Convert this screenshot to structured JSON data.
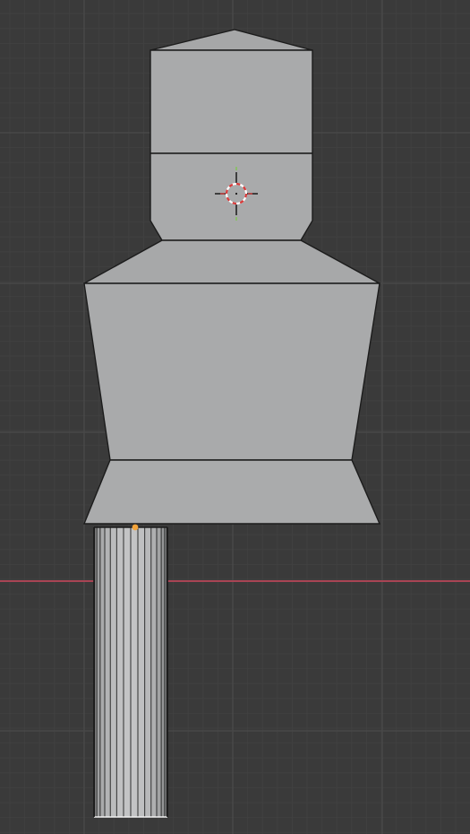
{
  "viewport": {
    "editor": "3d-viewport",
    "view": "front-orthographic",
    "background_color": "#3a3a3a",
    "grid_minor_color": "#404040",
    "grid_major_color": "#4a4a4a",
    "x_axis_color": "#a84454",
    "mesh_face_color": "#a9aaab",
    "mesh_edge_color": "#1c1c1c",
    "selected_vertex_color": "#f4a43a",
    "selected_edge_color": "#f0f0f0"
  },
  "objects": [
    {
      "name": "figure-body",
      "selected": false
    },
    {
      "name": "cylinder-leg",
      "selected": true,
      "edit_mode": true
    }
  ],
  "cursor": {
    "icon": "3d-cursor-icon"
  }
}
